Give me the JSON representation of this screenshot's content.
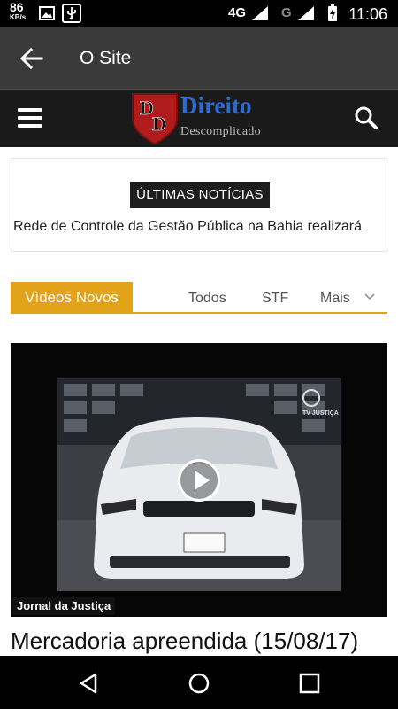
{
  "status_bar": {
    "speed_value": "86",
    "speed_unit": "KB/s",
    "network_4g": "4G",
    "network_g": "G",
    "time": "11:06"
  },
  "app_bar": {
    "title": "O Site",
    "back_icon": "arrow-left-icon"
  },
  "site_header": {
    "logo_letters": "DD",
    "logo_word": "Direito",
    "logo_sub": "Descomplicado",
    "menu_icon": "hamburger-icon",
    "search_icon": "search-icon"
  },
  "news": {
    "badge": "ÚLTIMAS NOTÍCIAS",
    "ticker": "Rede de Controle da Gestão Pública na Bahia realizará"
  },
  "tabs": {
    "active": "Vídeos Novos",
    "items": [
      "Todos",
      "STF",
      "Mais"
    ]
  },
  "video": {
    "label": "Jornal da Justiça",
    "watermark": "TV JUSTIÇA",
    "title": "Mercadoria apreendida (15/08/17)"
  },
  "nav_bar": {
    "icons": [
      "back-triangle-icon",
      "home-circle-icon",
      "recents-square-icon"
    ]
  },
  "colors": {
    "accent": "#e2a21a",
    "app_bar": "#3a3a3a",
    "site_header": "#1a1a1a",
    "logo_blue": "#2c6bd6",
    "logo_shield": "#b01c1c"
  }
}
